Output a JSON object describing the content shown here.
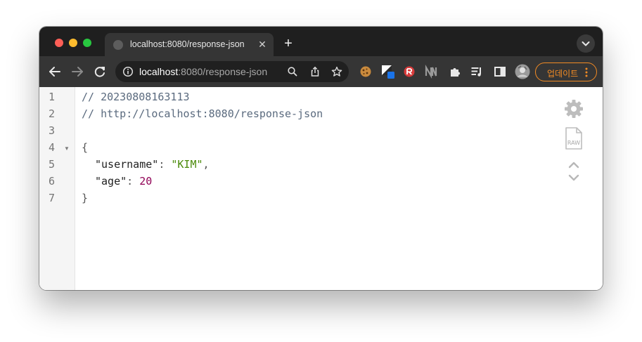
{
  "tab": {
    "title": "localhost:8080/response-json",
    "close_glyph": "✕",
    "new_tab_glyph": "+"
  },
  "toolbar": {
    "url_host": "localhost",
    "url_rest": ":8080/response-json",
    "update_label": "업데이트"
  },
  "icons": {
    "back": "back-arrow-icon",
    "forward": "forward-arrow-icon",
    "reload": "reload-icon",
    "info": "info-icon",
    "zoom": "search-icon",
    "share": "share-icon",
    "bookmark": "star-icon",
    "extensions": [
      "cookie-icon",
      "json-extension-icon",
      "red-extension-icon",
      "n-extension-icon",
      "puzzle-icon",
      "queue-icon",
      "sidepanel-icon",
      "profile-avatar-icon"
    ],
    "settings": "gear-icon",
    "raw": "raw-file-icon",
    "collapse": "collapse-icon"
  },
  "raw_label": "RAW",
  "fold_marker": "▼",
  "viewer": {
    "lines": [
      {
        "no": "1",
        "comment": "// 20230808163113"
      },
      {
        "no": "2",
        "comment": "// http://localhost:8080/response-json"
      },
      {
        "no": "3"
      },
      {
        "no": "4",
        "brace": "{"
      },
      {
        "no": "5",
        "key": "\"username\"",
        "sep": ": ",
        "value": "\"KIM\"",
        "trail": ","
      },
      {
        "no": "6",
        "key": "\"age\"",
        "sep": ": ",
        "value": "20"
      },
      {
        "no": "7",
        "brace": "}"
      }
    ]
  },
  "colors": {
    "accent_update": "#f28b24",
    "string": "#4a8a0a",
    "number": "#900055",
    "comment": "#5a6a7e"
  }
}
